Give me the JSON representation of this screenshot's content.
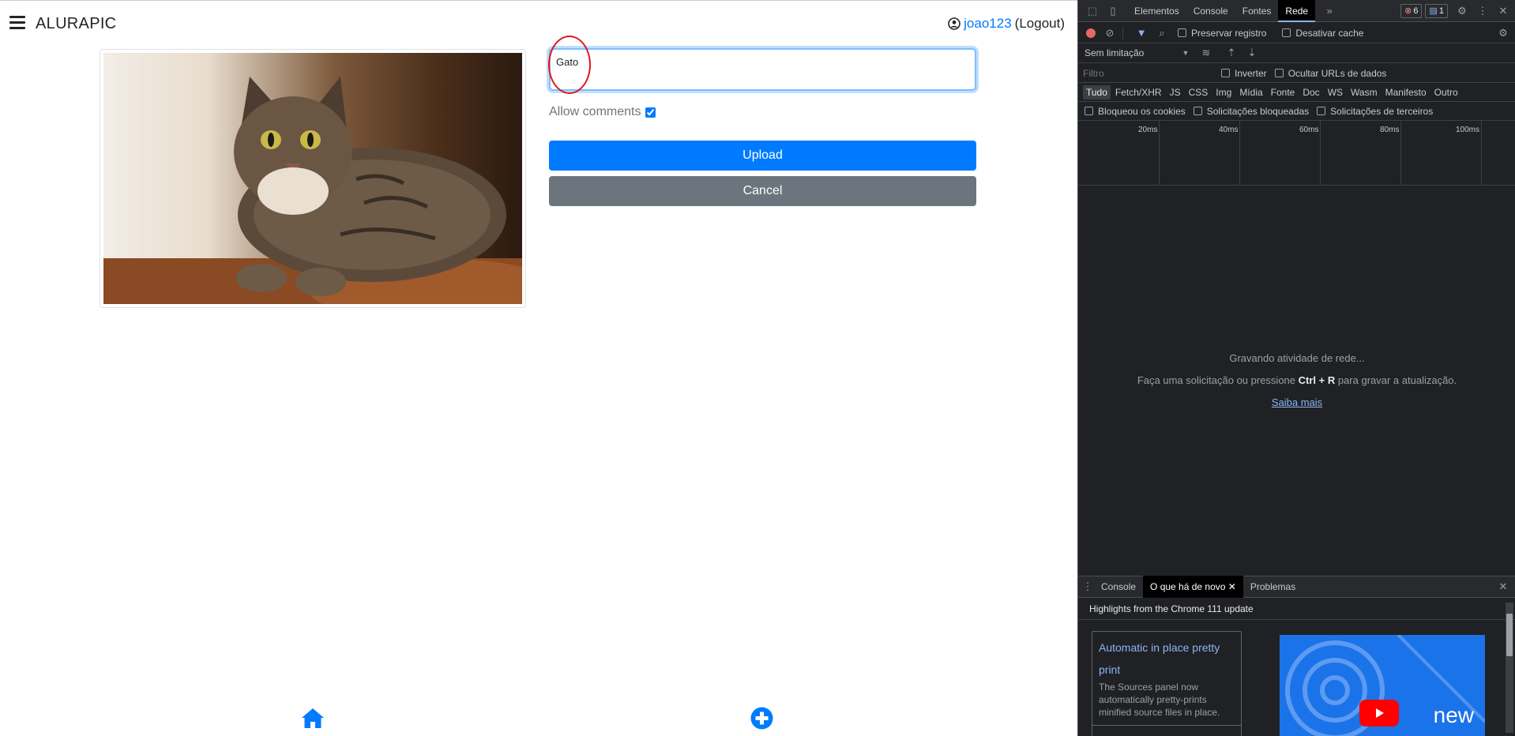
{
  "app": {
    "brand": "ALURAPIC",
    "user": {
      "username": "joao123",
      "logout": "(Logout)"
    },
    "form": {
      "description_value": "Gato",
      "allow_comments_label": "Allow comments",
      "allow_comments_checked": true,
      "upload_label": "Upload",
      "cancel_label": "Cancel"
    },
    "icons": {
      "menu": "menu-icon",
      "user": "user-circle-icon",
      "home": "home-icon",
      "add": "plus-circle-icon"
    },
    "colors": {
      "primary": "#007bff",
      "secondary": "#6c757d",
      "highlight": "#e0151b"
    }
  },
  "devtools": {
    "tabs": [
      "Elementos",
      "Console",
      "Fontes",
      "Rede"
    ],
    "active_tab": "Rede",
    "errors": "6",
    "messages": "1",
    "toolbar": {
      "preserve_log": "Preservar registro",
      "disable_cache": "Desativar cache"
    },
    "throttle": "Sem limitação",
    "filter": {
      "placeholder": "Filtro",
      "invert": "Inverter",
      "hide_data_urls": "Ocultar URLs de dados"
    },
    "types": [
      "Tudo",
      "Fetch/XHR",
      "JS",
      "CSS",
      "Img",
      "Mídia",
      "Fonte",
      "Doc",
      "WS",
      "Wasm",
      "Manifesto",
      "Outro"
    ],
    "blocked": {
      "blocked_cookies": "Bloqueou os cookies",
      "blocked_requests": "Solicitações bloqueadas",
      "third_party": "Solicitações de terceiros"
    },
    "timeline_ticks": [
      "20ms",
      "40ms",
      "60ms",
      "80ms",
      "100ms"
    ],
    "empty": {
      "line1": "Gravando atividade de rede...",
      "line2_pre": "Faça uma solicitação ou pressione ",
      "shortcut": "Ctrl + R",
      "line2_post": " para gravar a atualização.",
      "learn_more": "Saiba mais"
    },
    "drawer": {
      "tabs": [
        "Console",
        "O que há de novo",
        "Problemas"
      ],
      "active_tab": "O que há de novo",
      "heading": "Highlights from the Chrome 111 update",
      "feature_title": "Automatic in place pretty print",
      "feature_desc": "The Sources panel now automatically pretty-prints minified source files in place.",
      "promo_text": "new"
    }
  }
}
